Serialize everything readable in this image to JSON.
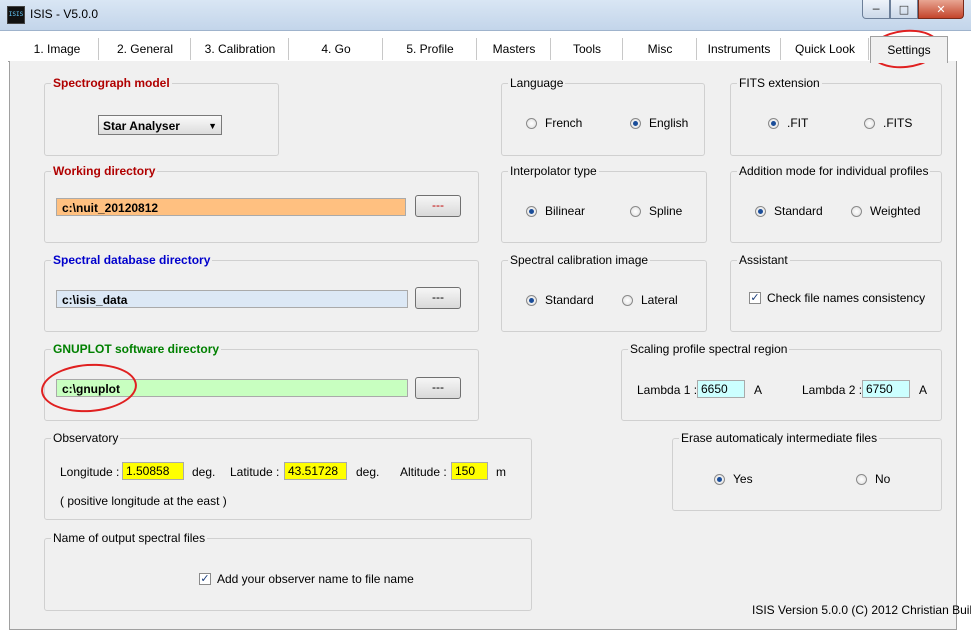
{
  "window": {
    "title": "ISIS - V5.0.0",
    "icon_text": "ISIS",
    "icon": "isis-app-icon"
  },
  "tabs": [
    {
      "label": "1. Image"
    },
    {
      "label": "2. General"
    },
    {
      "label": "3. Calibration"
    },
    {
      "label": "4. Go"
    },
    {
      "label": "5. Profile"
    },
    {
      "label": "Masters"
    },
    {
      "label": "Tools"
    },
    {
      "label": "Misc"
    },
    {
      "label": "Instruments"
    },
    {
      "label": "Quick Look"
    },
    {
      "label": "Settings"
    }
  ],
  "active_tab": "Settings",
  "spectrograph": {
    "title": "Spectrograph model",
    "value": "Star Analyser"
  },
  "working_dir": {
    "title": "Working directory",
    "value": "c:\\nuit_20120812",
    "button": "---",
    "color": "#ffc080"
  },
  "spectral_db": {
    "title": "Spectral database directory",
    "value": "c:\\isis_data",
    "button": "---",
    "color": "#dce8f5"
  },
  "gnuplot": {
    "title": "GNUPLOT software directory",
    "value": "c:\\gnuplot",
    "button": "---",
    "color": "#c8ffc0"
  },
  "observatory": {
    "title": "Observatory",
    "longitude_label": "Longitude :",
    "longitude": "1.50858",
    "longitude_unit": "deg.",
    "latitude_label": "Latitude :",
    "latitude": "43.51728",
    "latitude_unit": "deg.",
    "altitude_label": "Altitude :",
    "altitude": "150",
    "altitude_unit": "m",
    "note": "( positive longitude at the east )"
  },
  "output_names": {
    "title": "Name of output spectral files",
    "checkbox": "Add your observer name to file name",
    "checked": true
  },
  "language": {
    "title": "Language",
    "options": [
      "French",
      "English"
    ],
    "selected": "English"
  },
  "fits": {
    "title": "FITS extension",
    "options": [
      ".FIT",
      ".FITS"
    ],
    "selected": ".FIT"
  },
  "interpolator": {
    "title": "Interpolator type",
    "options": [
      "Bilinear",
      "Spline"
    ],
    "selected": "Bilinear"
  },
  "addition": {
    "title": "Addition mode for individual profiles",
    "options": [
      "Standard",
      "Weighted"
    ],
    "selected": "Standard"
  },
  "calib_image": {
    "title": "Spectral calibration image",
    "options": [
      "Standard",
      "Lateral"
    ],
    "selected": "Standard"
  },
  "assistant": {
    "title": "Assistant",
    "checkbox": "Check file names consistency",
    "checked": true
  },
  "scaling": {
    "title": "Scaling profile spectral region",
    "lambda1_label": "Lambda 1 :",
    "lambda1": "6650",
    "lambda2_label": "Lambda 2 :",
    "lambda2": "6750",
    "unit": "A"
  },
  "erase": {
    "title": "Erase automaticaly intermediate files",
    "options": [
      "Yes",
      "No"
    ],
    "selected": "Yes"
  },
  "footer": {
    "version": "ISIS Version 5.0.0 (C) 2012 Christian Buil"
  },
  "colors": {
    "annotation": "#e02020",
    "highlight_yellow": "#ffff00",
    "lambda_cyan": "#ccffff"
  }
}
